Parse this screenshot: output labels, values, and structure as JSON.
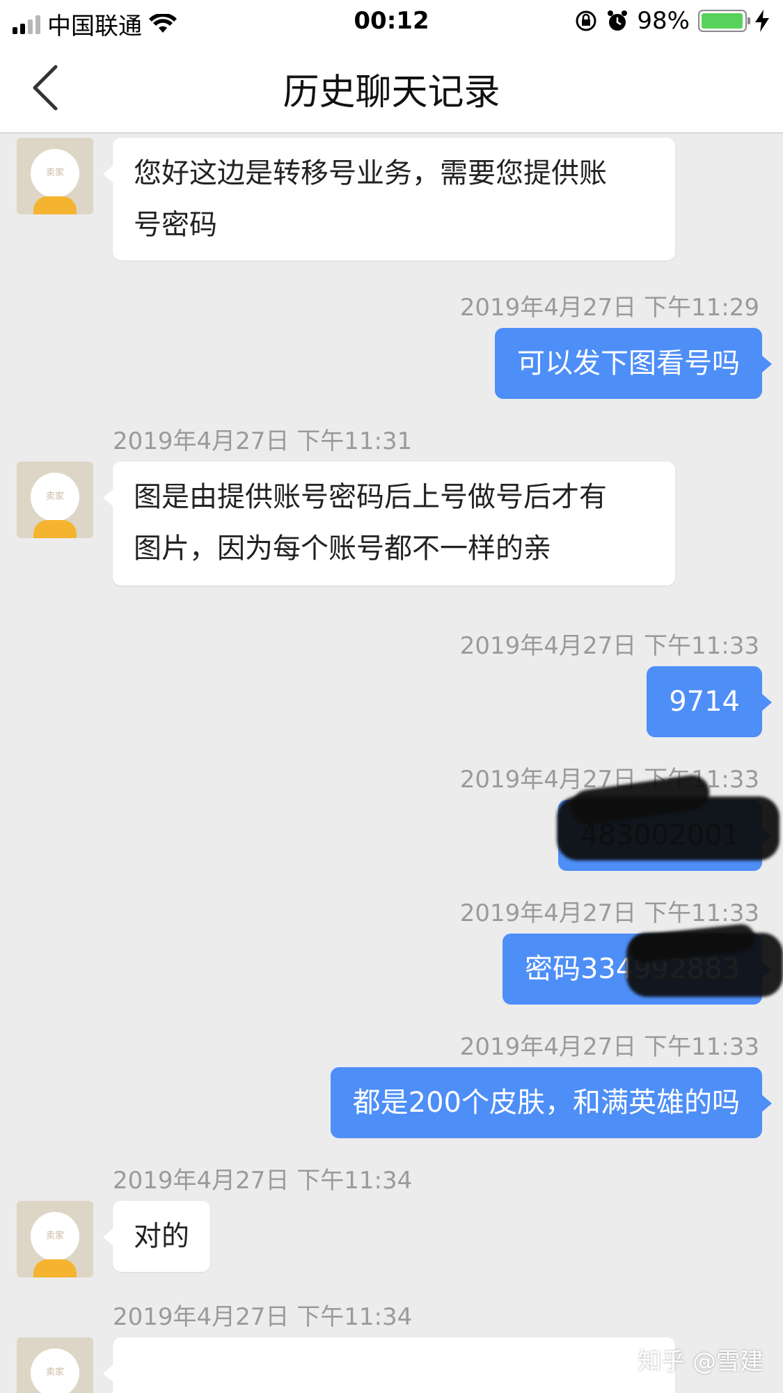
{
  "status_bar": {
    "carrier": "中国联通",
    "time": "00:12",
    "battery_percent": "98%",
    "battery_level": 0.98,
    "battery_color": "#58d25a"
  },
  "nav": {
    "title": "历史聊天记录"
  },
  "avatar_label": "卖家",
  "messages": [
    {
      "side": "in",
      "text_line1": "您好这边是转移号业务，需要您提供账",
      "text_line2": "号密码"
    },
    {
      "side": "out",
      "timestamp": "2019年4月27日 下午11:29",
      "text": "可以发下图看号吗"
    },
    {
      "side": "in",
      "timestamp": "2019年4月27日 下午11:31",
      "text_line1": "图是由提供账号密码后上号做号后才有",
      "text_line2": "图片，因为每个账号都不一样的亲"
    },
    {
      "side": "out",
      "timestamp": "2019年4月27日 下午11:33",
      "text": "9714"
    },
    {
      "side": "out",
      "timestamp": "2019年4月27日 下午11:33",
      "text": "483002001"
    },
    {
      "side": "out",
      "timestamp": "2019年4月27日 下午11:33",
      "text": "密码334992883"
    },
    {
      "side": "out",
      "timestamp": "2019年4月27日 下午11:33",
      "text": "都是200个皮肤，和满英雄的吗"
    },
    {
      "side": "in",
      "timestamp": "2019年4月27日 下午11:34",
      "text": "对的"
    },
    {
      "side": "in",
      "timestamp": "2019年4月27日 下午11:34",
      "text": ""
    }
  ],
  "watermark": "知乎 @雪建",
  "colors": {
    "outgoing_bubble": "#4e8ef7",
    "incoming_bubble": "#ffffff",
    "background": "#ececed"
  }
}
